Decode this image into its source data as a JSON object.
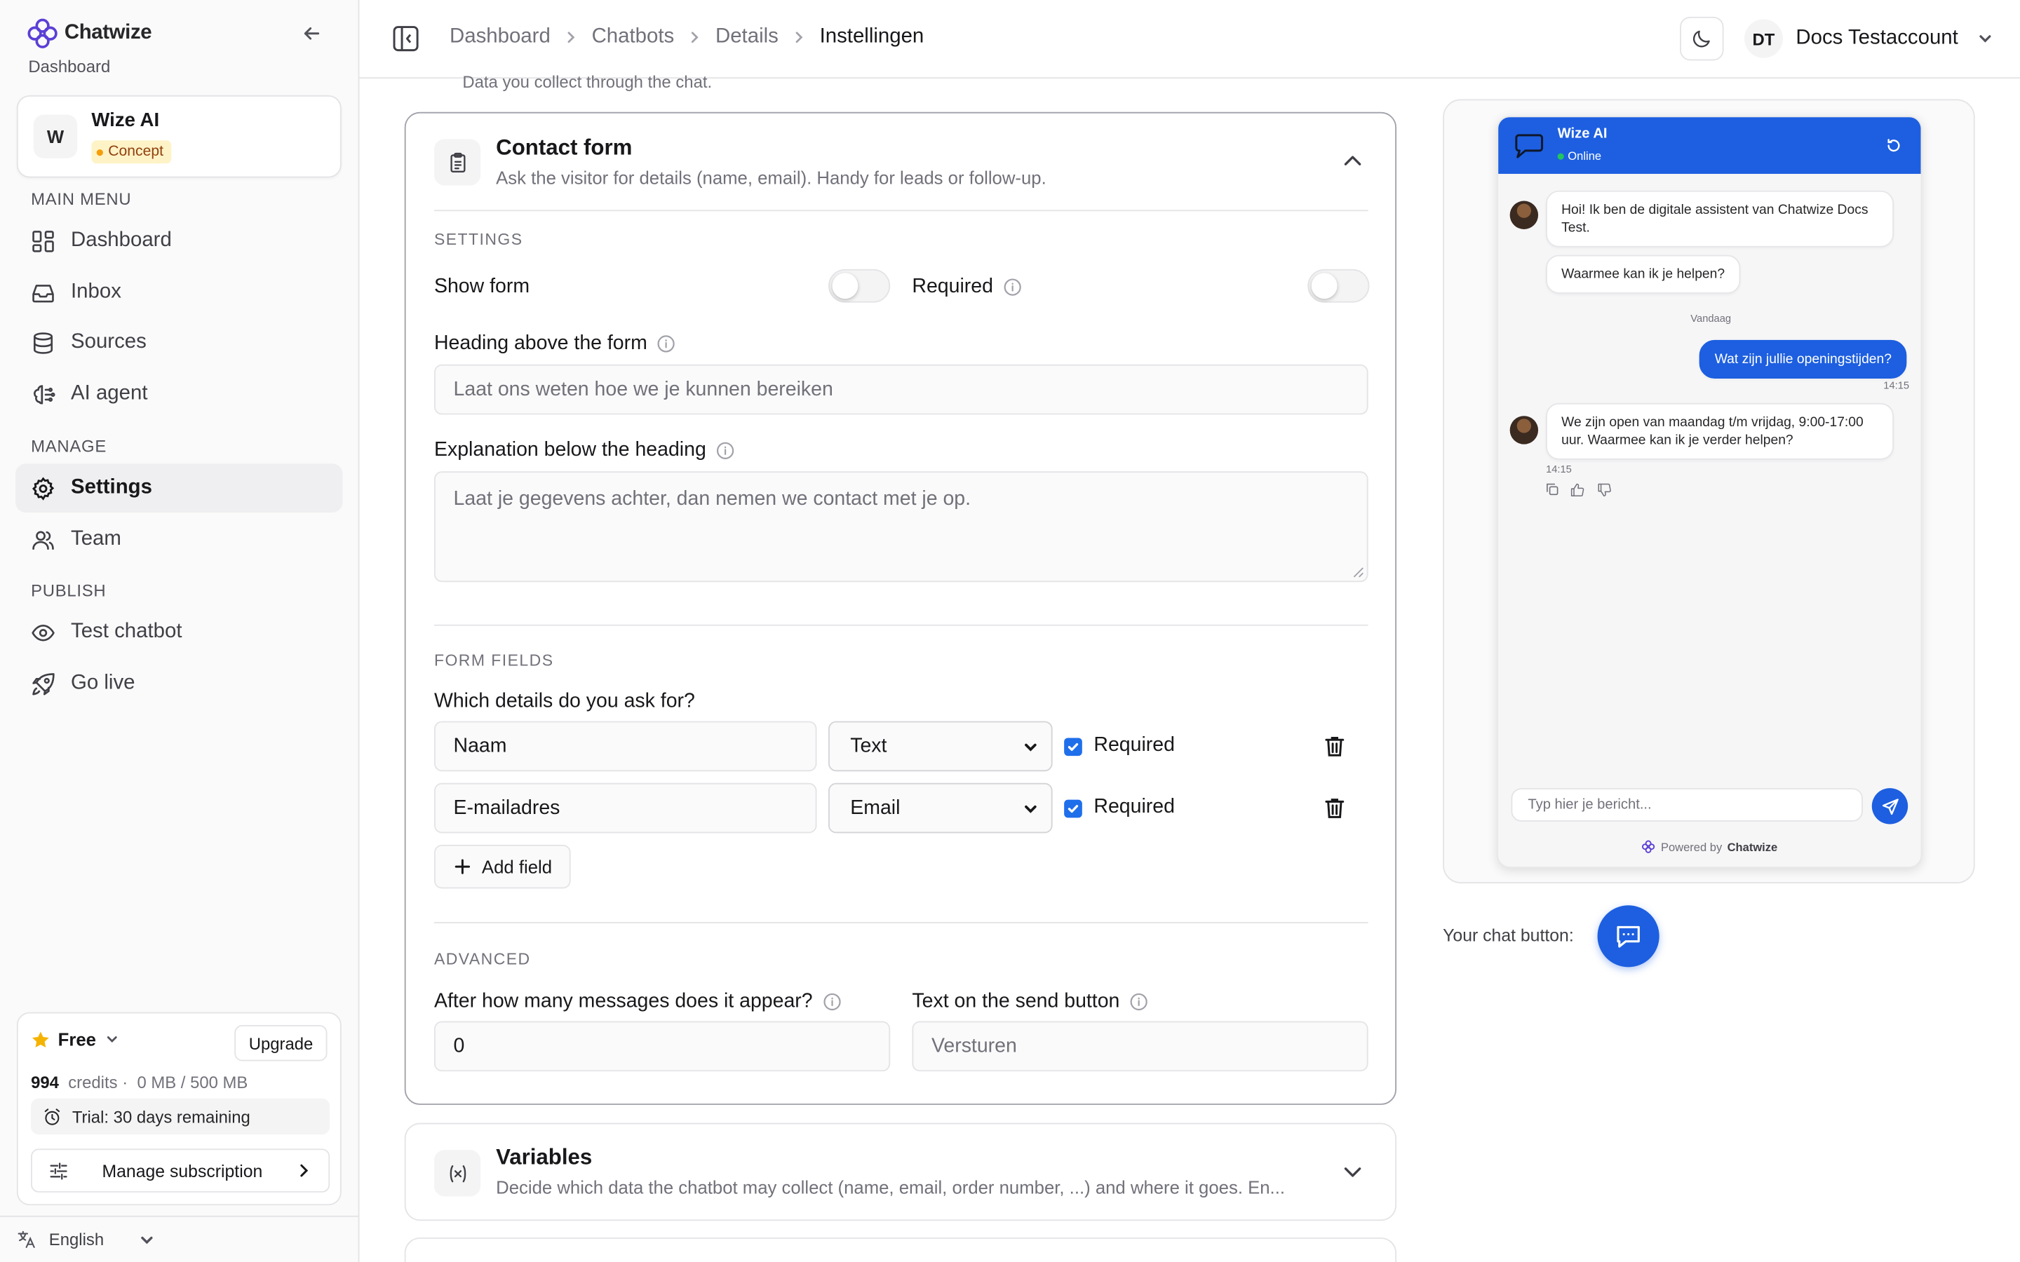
{
  "brand": {
    "name": "Chatwize",
    "subtitle": "Dashboard"
  },
  "workspace": {
    "initial": "W",
    "name": "Wize AI",
    "badge": "Concept"
  },
  "nav": {
    "main_menu_label": "MAIN MENU",
    "manage_label": "MANAGE",
    "publish_label": "PUBLISH",
    "items": {
      "dashboard": "Dashboard",
      "inbox": "Inbox",
      "sources": "Sources",
      "ai_agent": "AI agent",
      "settings": "Settings",
      "team": "Team",
      "test_chatbot": "Test chatbot",
      "go_live": "Go live"
    }
  },
  "plan": {
    "name": "Free",
    "upgrade_label": "Upgrade",
    "credits_value": "994",
    "credits_label": "credits",
    "storage": "0 MB / 500 MB",
    "trial": "Trial: 30 days remaining",
    "manage_label": "Manage subscription"
  },
  "language": "English",
  "breadcrumb": [
    "Dashboard",
    "Chatbots",
    "Details",
    "Instellingen"
  ],
  "user": {
    "initials": "DT",
    "name": "Docs Testaccount"
  },
  "main": {
    "partial_desc": "Data you collect through the chat.",
    "contact_form": {
      "title": "Contact form",
      "description": "Ask the visitor for details (name, email). Handy for leads or follow-up.",
      "settings_label": "SETTINGS",
      "show_form_label": "Show form",
      "required_label": "Required",
      "heading_label": "Heading above the form",
      "heading_placeholder": "Laat ons weten hoe we je kunnen bereiken",
      "explanation_label": "Explanation below the heading",
      "explanation_placeholder": "Laat je gegevens achter, dan nemen we contact met je op.",
      "form_fields_label": "FORM FIELDS",
      "which_details_label": "Which details do you ask for?",
      "fields": [
        {
          "name": "Naam",
          "type": "Text",
          "required_label": "Required"
        },
        {
          "name": "E-mailadres",
          "type": "Email",
          "required_label": "Required"
        }
      ],
      "add_field_label": "Add field",
      "advanced_label": "ADVANCED",
      "after_messages_label": "After how many messages does it appear?",
      "after_messages_value": "0",
      "send_button_label": "Text on the send button",
      "send_button_placeholder": "Versturen"
    },
    "variables": {
      "title": "Variables",
      "description": "Decide which data the chatbot may collect (name, email, order number, ...) and where it goes. En..."
    }
  },
  "preview": {
    "bot_name": "Wize AI",
    "status": "Online",
    "messages": {
      "greeting": "Hoi! Ik ben de digitale assistent van Chatwize Docs Test.",
      "followup": "Waarmee kan ik je helpen?",
      "date_divider": "Vandaag",
      "user_msg": "Wat zijn jullie openingstijden?",
      "user_time": "14:15",
      "bot_reply": "We zijn open van maandag t/m vrijdag, 9:00-17:00 uur. Waarmee kan ik je verder helpen?",
      "bot_time": "14:15"
    },
    "input_placeholder": "Typ hier je bericht...",
    "powered_by": "Powered by",
    "powered_brand": "Chatwize",
    "chat_button_label": "Your chat button:"
  },
  "colors": {
    "accent": "#1d5fe0",
    "checkbox": "#1f6feb",
    "badge_bg": "#fef3c7"
  }
}
